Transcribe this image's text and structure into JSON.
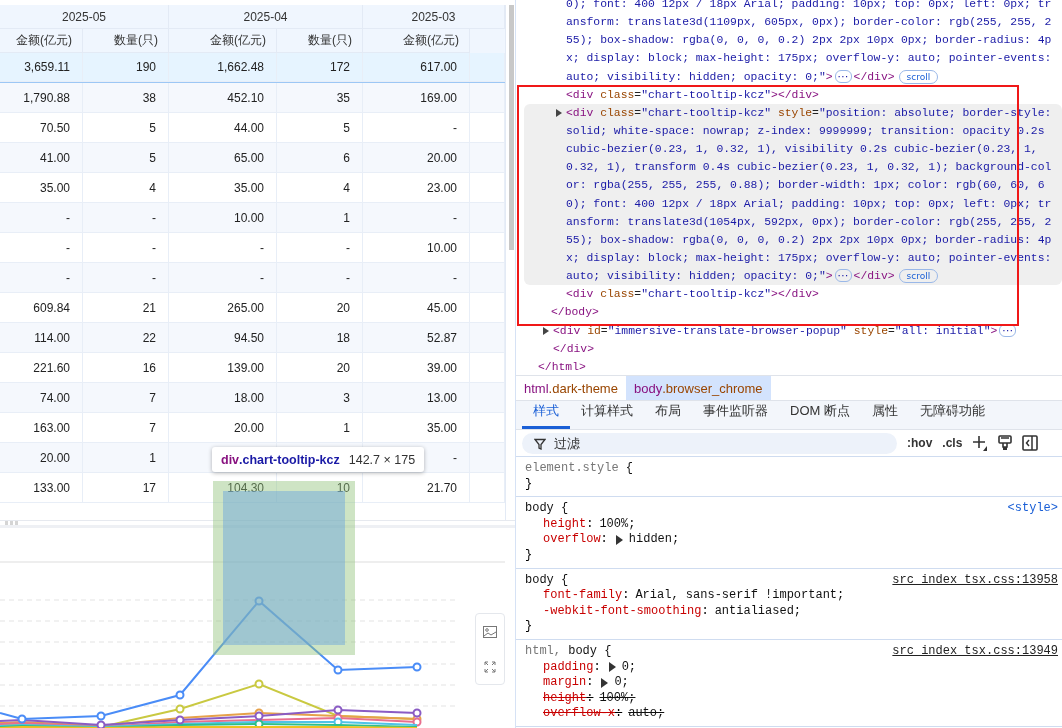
{
  "table": {
    "groups": [
      {
        "label": "2025-05"
      },
      {
        "label": "2025-04"
      },
      {
        "label": "2025-03"
      }
    ],
    "columns": [
      {
        "label": "金额(亿元)"
      },
      {
        "label": "数量(只)"
      },
      {
        "label": "金额(亿元)"
      },
      {
        "label": "数量(只)"
      },
      {
        "label": "金额(亿元)"
      }
    ],
    "rows": [
      {
        "selected": true,
        "cells": [
          "3,659.11",
          "190",
          "1,662.48",
          "172",
          "617.00"
        ]
      },
      {
        "selected": false,
        "cells": [
          "1,790.88",
          "38",
          "452.10",
          "35",
          "169.00"
        ]
      },
      {
        "selected": false,
        "cells": [
          "70.50",
          "5",
          "44.00",
          "5",
          "-"
        ]
      },
      {
        "selected": false,
        "cells": [
          "41.00",
          "5",
          "65.00",
          "6",
          "20.00"
        ]
      },
      {
        "selected": false,
        "cells": [
          "35.00",
          "4",
          "35.00",
          "4",
          "23.00"
        ]
      },
      {
        "selected": false,
        "cells": [
          "-",
          "-",
          "10.00",
          "1",
          "-"
        ]
      },
      {
        "selected": false,
        "cells": [
          "-",
          "-",
          "-",
          "-",
          "10.00"
        ]
      },
      {
        "selected": false,
        "cells": [
          "-",
          "-",
          "-",
          "-",
          "-"
        ]
      },
      {
        "selected": false,
        "cells": [
          "609.84",
          "21",
          "265.00",
          "20",
          "45.00"
        ]
      },
      {
        "selected": false,
        "cells": [
          "114.00",
          "22",
          "94.50",
          "18",
          "52.87"
        ]
      },
      {
        "selected": false,
        "cells": [
          "221.60",
          "16",
          "139.00",
          "20",
          "39.00"
        ]
      },
      {
        "selected": false,
        "cells": [
          "74.00",
          "7",
          "18.00",
          "3",
          "13.00"
        ]
      },
      {
        "selected": false,
        "cells": [
          "163.00",
          "7",
          "20.00",
          "1",
          "35.00"
        ]
      },
      {
        "selected": false,
        "cells": [
          "20.00",
          "1",
          null,
          null,
          "-"
        ]
      },
      {
        "selected": false,
        "cells": [
          "133.00",
          "17",
          "104.30",
          "10",
          "21.70"
        ]
      }
    ]
  },
  "inspector_tooltip": {
    "tag": "div",
    "class": ".chart-tooltip-kcz",
    "size": "142.7 × 175"
  },
  "devtools": {
    "dom_nodes": [
      {
        "kind": "child",
        "selected": false,
        "expander": false,
        "lines": [
          [
            {
              "kind": "val",
              "t": "0); font: 400 12px / 18px Arial; padding: 10px; top: 0px; left: 0px; tr"
            }
          ],
          [
            {
              "kind": "val",
              "t": "ansform: translate3d(1109px, 605px, 0px); border-color: rgb(255, 255, 2"
            }
          ],
          [
            {
              "kind": "val",
              "t": "55); box-shadow: rgba(0, 0, 0, 0.2) 2px 2px 10px 0px; border-radius: 4p"
            }
          ],
          [
            {
              "kind": "val",
              "t": "x; display: block; max-height: 175px; overflow-y: auto; pointer-events:"
            }
          ],
          [
            {
              "kind": "val",
              "t": "auto; visibility: hidden; opacity: 0;\""
            },
            {
              "kind": "tag",
              "t": ">"
            },
            {
              "kind": "ellipsis",
              "t": "⋯"
            },
            {
              "kind": "tag",
              "t": "</div>"
            },
            {
              "kind": "badge",
              "t": "scroll"
            }
          ]
        ]
      },
      {
        "kind": "child",
        "selected": false,
        "expander": false,
        "lines": [
          [
            {
              "kind": "tag",
              "t": "<div"
            },
            {
              "kind": "attr",
              "t": " class"
            },
            {
              "kind": "text",
              "t": "="
            },
            {
              "kind": "val",
              "t": "\"chart-tooltip-kcz\""
            },
            {
              "kind": "tag",
              "t": "></div>"
            }
          ]
        ]
      },
      {
        "kind": "child",
        "selected": true,
        "expander": true,
        "lines": [
          [
            {
              "kind": "tag",
              "t": "<div"
            },
            {
              "kind": "attr",
              "t": " class"
            },
            {
              "kind": "text",
              "t": "="
            },
            {
              "kind": "val",
              "t": "\"chart-tooltip-kcz\""
            },
            {
              "kind": "attr",
              "t": " style"
            },
            {
              "kind": "text",
              "t": "="
            },
            {
              "kind": "val",
              "t": "\"position: absolute; border-style:"
            }
          ],
          [
            {
              "kind": "val",
              "t": "solid; white-space: nowrap; z-index: 9999999; transition: opacity 0.2s"
            }
          ],
          [
            {
              "kind": "val",
              "t": "cubic-bezier(0.23, 1, 0.32, 1), visibility 0.2s cubic-bezier(0.23, 1,"
            }
          ],
          [
            {
              "kind": "val",
              "t": "0.32, 1), transform 0.4s cubic-bezier(0.23, 1, 0.32, 1); background-col"
            }
          ],
          [
            {
              "kind": "val",
              "t": "or: rgba(255, 255, 255, 0.88); border-width: 1px; color: rgb(60, 60, 6"
            }
          ],
          [
            {
              "kind": "val",
              "t": "0); font: 400 12px / 18px Arial; padding: 10px; top: 0px; left: 0px; tr"
            }
          ],
          [
            {
              "kind": "val",
              "t": "ansform: translate3d(1054px, 592px, 0px); border-color: rgb(255, 255, 2"
            }
          ],
          [
            {
              "kind": "val",
              "t": "55); box-shadow: rgba(0, 0, 0, 0.2) 2px 2px 10px 0px; border-radius: 4p"
            }
          ],
          [
            {
              "kind": "val",
              "t": "x; display: block; max-height: 175px; overflow-y: auto; pointer-events:"
            }
          ],
          [
            {
              "kind": "val",
              "t": "auto; visibility: hidden; opacity: 0;\""
            },
            {
              "kind": "tag",
              "t": ">"
            },
            {
              "kind": "ellipsis",
              "t": "⋯"
            },
            {
              "kind": "tag",
              "t": "</div>"
            },
            {
              "kind": "badge",
              "t": "scroll"
            }
          ]
        ]
      },
      {
        "kind": "child",
        "selected": false,
        "expander": false,
        "lines": [
          [
            {
              "kind": "tag",
              "t": "<div"
            },
            {
              "kind": "attr",
              "t": " class"
            },
            {
              "kind": "text",
              "t": "="
            },
            {
              "kind": "val",
              "t": "\"chart-tooltip-kcz\""
            },
            {
              "kind": "tag",
              "t": "></div>"
            }
          ]
        ]
      },
      {
        "kind": "body-close",
        "selected": false,
        "expander": false,
        "lines": [
          [
            {
              "kind": "tag",
              "t": "</body>"
            }
          ]
        ]
      },
      {
        "kind": "sibling",
        "selected": false,
        "expander": true,
        "lines": [
          [
            {
              "kind": "tag",
              "t": "<div"
            },
            {
              "kind": "attr",
              "t": " id"
            },
            {
              "kind": "text",
              "t": "="
            },
            {
              "kind": "val",
              "t": "\"immersive-translate-browser-popup\""
            },
            {
              "kind": "attr",
              "t": " style"
            },
            {
              "kind": "text",
              "t": "="
            },
            {
              "kind": "val",
              "t": "\"all: initial\""
            },
            {
              "kind": "tag",
              "t": ">"
            },
            {
              "kind": "ellipsis",
              "t": "⋯"
            }
          ]
        ]
      },
      {
        "kind": "sibling",
        "selected": false,
        "expander": false,
        "lines": [
          [
            {
              "kind": "tag",
              "t": "</div>"
            }
          ]
        ]
      },
      {
        "kind": "html-close",
        "selected": false,
        "expander": false,
        "lines": [
          [
            {
              "kind": "tag",
              "t": "</html>"
            }
          ]
        ]
      }
    ],
    "breadcrumbs": [
      {
        "tag": "html",
        "cls": ".dark-theme",
        "selected": false
      },
      {
        "tag": "body",
        "cls": ".browser_chrome",
        "selected": true
      }
    ],
    "tabs": [
      {
        "label": "样式",
        "selected": true
      },
      {
        "label": "计算样式",
        "selected": false
      },
      {
        "label": "布局",
        "selected": false
      },
      {
        "label": "事件监听器",
        "selected": false
      },
      {
        "label": "DOM 断点",
        "selected": false
      },
      {
        "label": "属性",
        "selected": false
      },
      {
        "label": "无障碍功能",
        "selected": false
      }
    ],
    "filter": {
      "placeholder": "过滤",
      "hov": ":hov",
      "cls": ".cls"
    },
    "rules": [
      {
        "selector": [
          {
            "t": "element.style",
            "matched": false
          }
        ],
        "open": "{",
        "close": "}"
      },
      {
        "selector": [
          {
            "t": "body",
            "matched": true
          }
        ],
        "open": "{",
        "close": "}",
        "source": {
          "t": "<style>",
          "kind": "link"
        },
        "props": [
          {
            "name": "height",
            "colon": ":",
            "value": "100%;",
            "struck": false,
            "expandable": false
          },
          {
            "name": "overflow",
            "colon": ":",
            "value": "hidden;",
            "struck": false,
            "expandable": true
          }
        ]
      },
      {
        "selector": [
          {
            "t": "body",
            "matched": true
          }
        ],
        "open": "{",
        "close": "}",
        "source": {
          "t": "src_index_tsx.css:13958",
          "kind": "file"
        },
        "props": [
          {
            "name": "font-family",
            "colon": ":",
            "value": "Arial, sans-serif !important;",
            "struck": false,
            "expandable": false
          },
          {
            "name": "-webkit-font-smoothing",
            "colon": ":",
            "value": "antialiased;",
            "struck": false,
            "expandable": false
          }
        ]
      },
      {
        "selector": [
          {
            "t": "html,",
            "matched": false
          },
          {
            "t": "body",
            "matched": true
          }
        ],
        "open": "{",
        "source": {
          "t": "src_index_tsx.css:13949",
          "kind": "file"
        },
        "props": [
          {
            "name": "padding",
            "colon": ":",
            "value": "0;",
            "struck": false,
            "expandable": true
          },
          {
            "name": "margin",
            "colon": ":",
            "value": "0;",
            "struck": false,
            "expandable": true
          },
          {
            "name": "height",
            "colon": ":",
            "value": "100%;",
            "struck": true,
            "expandable": false
          },
          {
            "name": "overflow-x",
            "colon": ":",
            "value": "auto;",
            "struck": true,
            "expandable": false
          }
        ]
      }
    ]
  }
}
